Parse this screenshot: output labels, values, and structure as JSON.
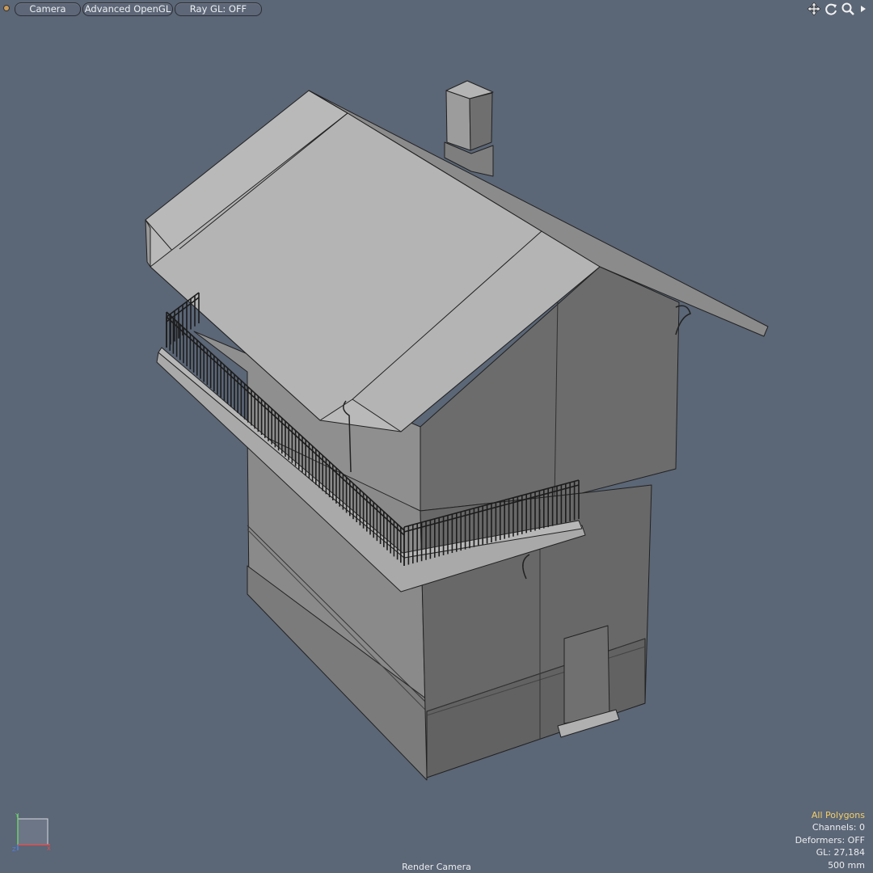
{
  "toolbar": {
    "camera_label": "Camera",
    "opengl_label": "Advanced OpenGL",
    "raygl_label": "Ray GL: OFF",
    "icons": [
      "move-view-icon",
      "rotate-view-icon",
      "zoom-view-icon",
      "menu-arrow-icon"
    ]
  },
  "hud": {
    "selection_mode": "All Polygons",
    "channels": "Channels: 0",
    "deformers": "Deformers: OFF",
    "gl": "GL: 27,184",
    "grid_size": "500 mm"
  },
  "camera_label": "Render Camera",
  "axis": {
    "y_label": "Y",
    "x_label": "X",
    "z_label": "Z"
  },
  "colors": {
    "background": "#5b6676",
    "hud_highlight": "#f4cf6a",
    "roof": "#b9b9b9",
    "wall_dark": "#686868",
    "wall_light": "#8a8a8a"
  }
}
